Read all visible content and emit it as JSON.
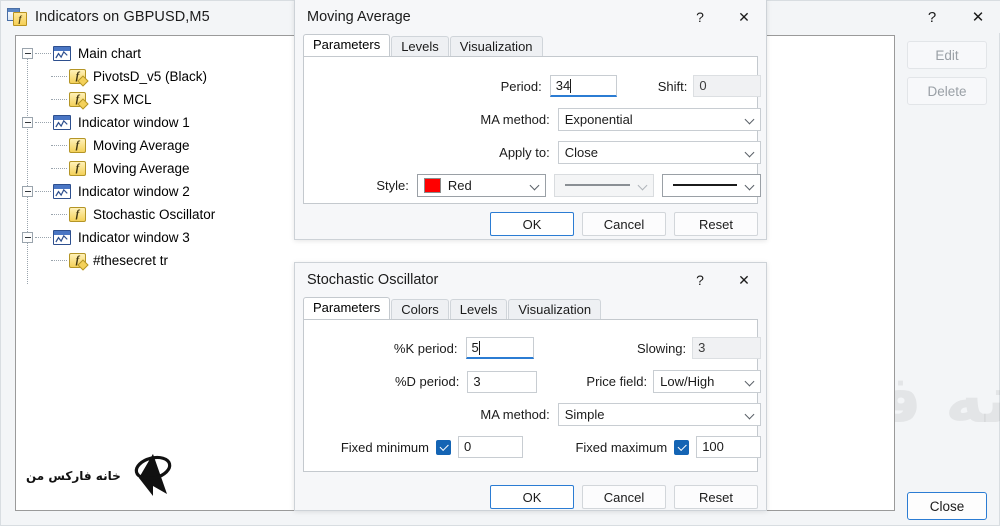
{
  "base_window": {
    "title": "Indicators on GBPUSD,M5",
    "icon": "indicators-window-icon",
    "help_glyph": "?",
    "close_glyph": "✕",
    "buttons": {
      "edit": "Edit",
      "delete": "Delete",
      "close": "Close"
    },
    "tree": [
      {
        "label": "Main chart",
        "level": 0,
        "icon": "chart-window-icon",
        "expander": true
      },
      {
        "label": "PivotsD_v5 (Black)",
        "level": 1,
        "icon": "indicator-fx-icon",
        "expander": false
      },
      {
        "label": "SFX MCL",
        "level": 1,
        "icon": "indicator-fx-icon",
        "expander": false
      },
      {
        "label": "Indicator window 1",
        "level": 0,
        "icon": "chart-window-icon",
        "expander": true
      },
      {
        "label": "Moving Average",
        "level": 1,
        "icon": "indicator-f-icon",
        "expander": false
      },
      {
        "label": "Moving Average",
        "level": 1,
        "icon": "indicator-f-icon",
        "expander": false
      },
      {
        "label": "Indicator window 2",
        "level": 0,
        "icon": "chart-window-icon",
        "expander": true
      },
      {
        "label": "Stochastic Oscillator",
        "level": 1,
        "icon": "indicator-f-icon",
        "expander": false
      },
      {
        "label": "Indicator window 3",
        "level": 0,
        "icon": "chart-window-icon",
        "expander": true
      },
      {
        "label": "#thesecret tr",
        "level": 1,
        "icon": "indicator-fx-icon",
        "expander": false
      }
    ]
  },
  "moving_average_dialog": {
    "title": "Moving Average",
    "help_glyph": "?",
    "close_glyph": "✕",
    "tabs": [
      {
        "label": "Parameters",
        "active": true
      },
      {
        "label": "Levels",
        "active": false
      },
      {
        "label": "Visualization",
        "active": false
      }
    ],
    "fields": {
      "period_label": "Period:",
      "period_value": "34",
      "shift_label": "Shift:",
      "shift_value": "0",
      "ma_method_label": "MA method:",
      "ma_method_value": "Exponential",
      "apply_to_label": "Apply to:",
      "apply_to_value": "Close",
      "style_label": "Style:",
      "style_color_name": "Red",
      "style_color_hex": "#ff0000"
    },
    "buttons": {
      "ok": "OK",
      "cancel": "Cancel",
      "reset": "Reset"
    }
  },
  "stochastic_dialog": {
    "title": "Stochastic Oscillator",
    "help_glyph": "?",
    "close_glyph": "✕",
    "tabs": [
      {
        "label": "Parameters",
        "active": true
      },
      {
        "label": "Colors",
        "active": false
      },
      {
        "label": "Levels",
        "active": false
      },
      {
        "label": "Visualization",
        "active": false
      }
    ],
    "fields": {
      "k_period_label": "%K period:",
      "k_period_value": "5",
      "slowing_label": "Slowing:",
      "slowing_value": "3",
      "d_period_label": "%D period:",
      "d_period_value": "3",
      "price_field_label": "Price field:",
      "price_field_value": "Low/High",
      "ma_method_label": "MA method:",
      "ma_method_value": "Simple",
      "fixed_minimum_label": "Fixed minimum",
      "fixed_minimum_checked": true,
      "fixed_minimum_value": "0",
      "fixed_maximum_label": "Fixed maximum",
      "fixed_maximum_checked": true,
      "fixed_maximum_value": "100"
    },
    "buttons": {
      "ok": "OK",
      "cancel": "Cancel",
      "reset": "Reset"
    }
  },
  "watermark": {
    "text": "خانه فارکس من",
    "logo_text": "خانه فارکس من"
  }
}
